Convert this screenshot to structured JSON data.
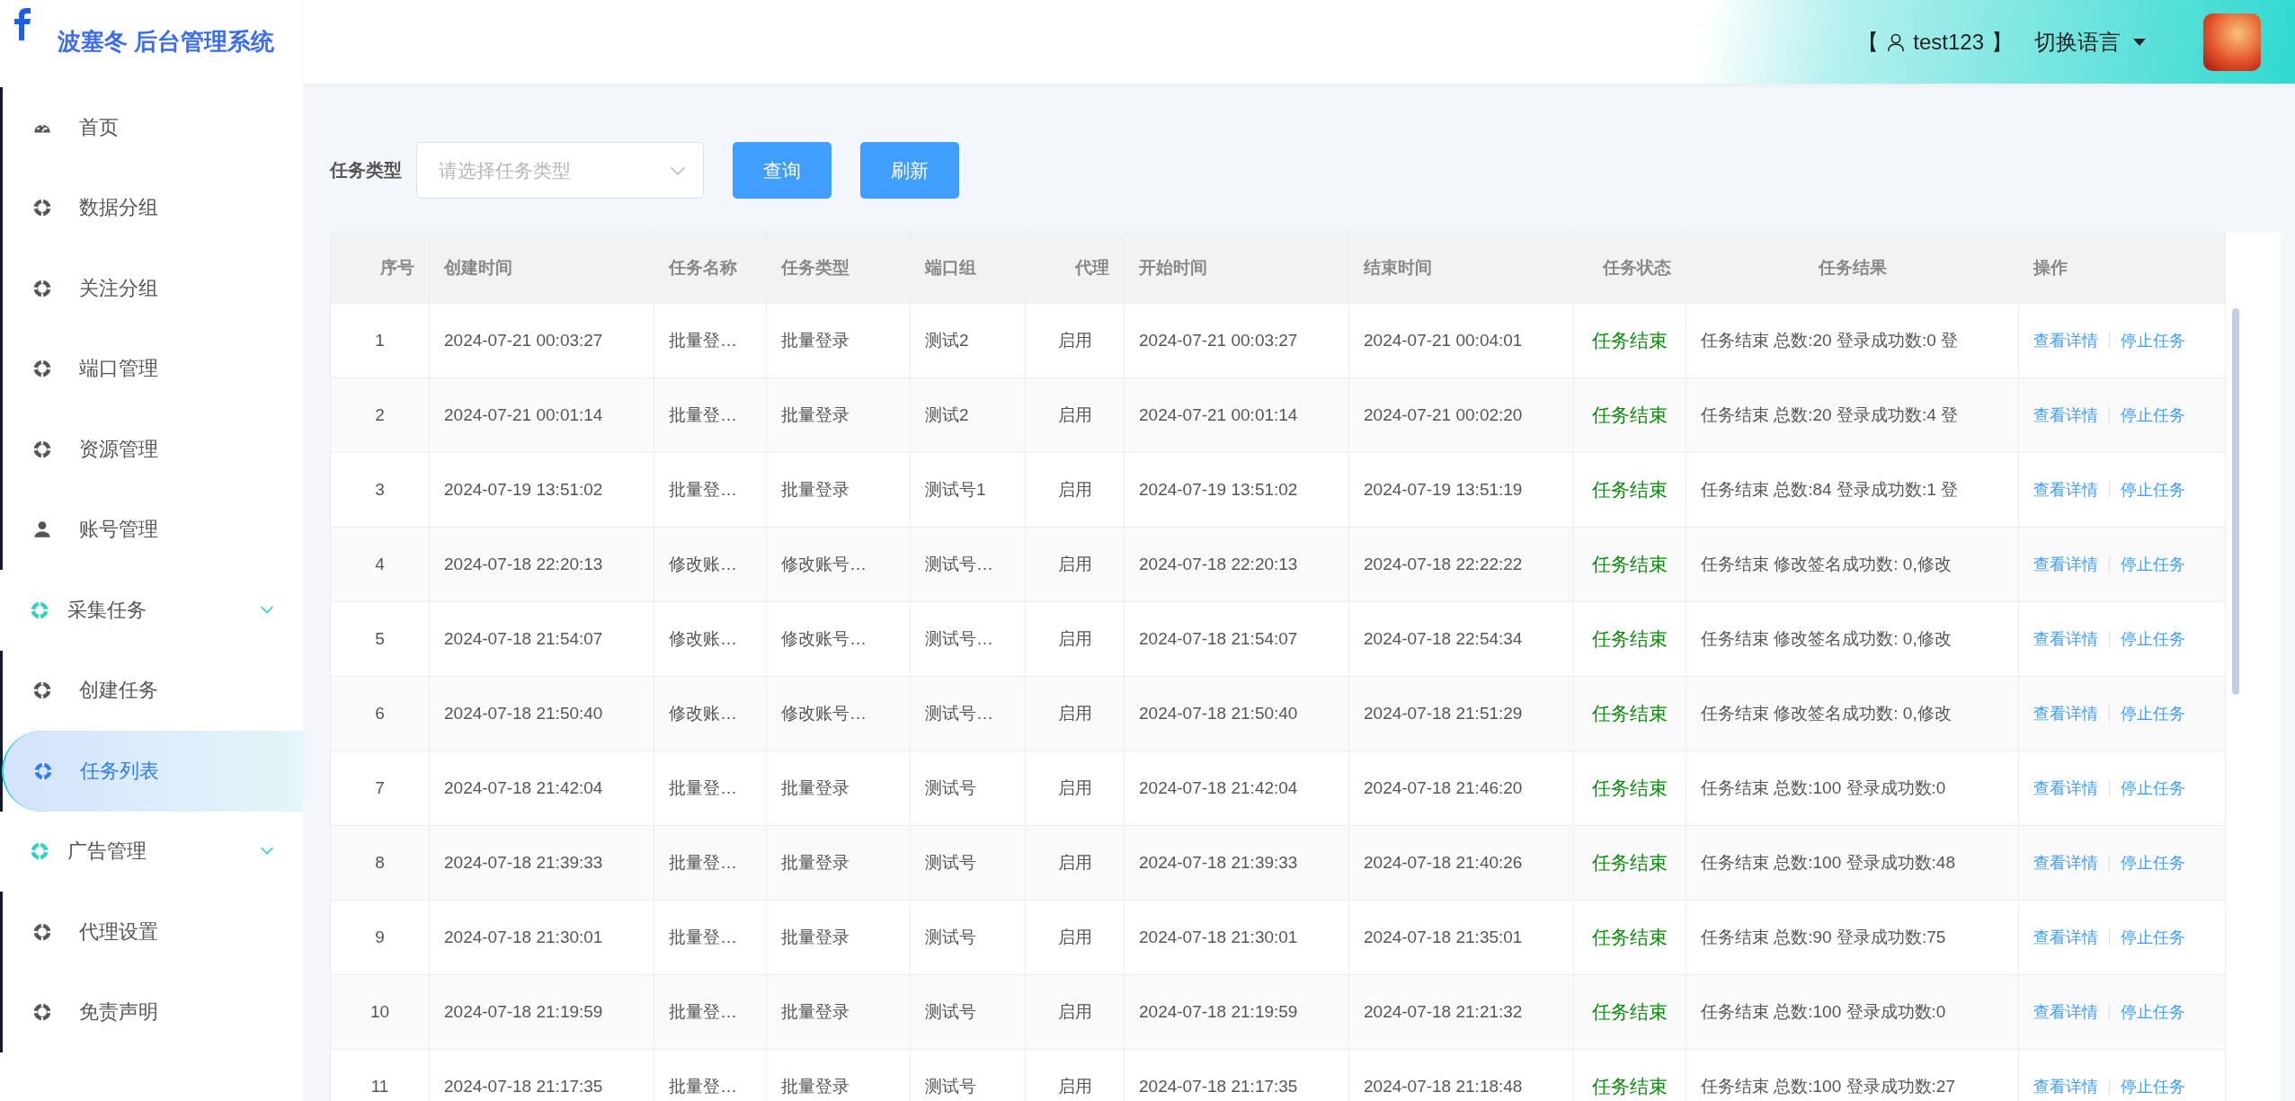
{
  "app": {
    "title": "波塞冬 后台管理系统"
  },
  "header": {
    "bracket_open": "【",
    "user": "test123",
    "bracket_close": "】",
    "language": "切换语言"
  },
  "sidebar": {
    "items": [
      {
        "label": "首页",
        "kind": "home",
        "selected": false
      },
      {
        "label": "数据分组",
        "kind": "item",
        "selected": false
      },
      {
        "label": "关注分组",
        "kind": "item",
        "selected": false
      },
      {
        "label": "端口管理",
        "kind": "item",
        "selected": false
      },
      {
        "label": "资源管理",
        "kind": "item",
        "selected": false
      },
      {
        "label": "账号管理",
        "kind": "account",
        "selected": false
      },
      {
        "label": "采集任务",
        "kind": "group",
        "expanded": true,
        "children": [
          {
            "label": "创建任务",
            "kind": "item",
            "selected": false
          },
          {
            "label": "任务列表",
            "kind": "item",
            "selected": true
          }
        ]
      },
      {
        "label": "广告管理",
        "kind": "group",
        "expanded": true,
        "children": [
          {
            "label": "代理设置",
            "kind": "item",
            "selected": false
          },
          {
            "label": "免责声明",
            "kind": "item",
            "selected": false
          }
        ]
      }
    ]
  },
  "filter": {
    "label": "任务类型",
    "placeholder": "请选择任务类型",
    "buttons": [
      "查询",
      "刷新"
    ]
  },
  "table": {
    "columns": [
      {
        "label": "序号",
        "kind": "index"
      },
      {
        "label": "创建时间",
        "kind": "text"
      },
      {
        "label": "任务名称",
        "kind": "text"
      },
      {
        "label": "任务类型",
        "kind": "text"
      },
      {
        "label": "端口组",
        "kind": "text"
      },
      {
        "label": "代理",
        "kind": "center"
      },
      {
        "label": "开始时间",
        "kind": "text"
      },
      {
        "label": "结束时间",
        "kind": "text"
      },
      {
        "label": "任务状态",
        "kind": "status"
      },
      {
        "label": "任务结果",
        "kind": "text"
      },
      {
        "label": "操作",
        "kind": "actions"
      }
    ],
    "rows": [
      {
        "cells": [
          "1",
          "2024-07-21 00:03:27",
          "批量登…",
          "批量登录",
          "测试2",
          "启用",
          "2024-07-21 00:03:27",
          "2024-07-21 00:04:01",
          "任务结束",
          "任务结束 总数:20 登录成功数:0 登"
        ],
        "actions": [
          "查看详情",
          "停止任务"
        ]
      },
      {
        "cells": [
          "2",
          "2024-07-21 00:01:14",
          "批量登…",
          "批量登录",
          "测试2",
          "启用",
          "2024-07-21 00:01:14",
          "2024-07-21 00:02:20",
          "任务结束",
          "任务结束 总数:20 登录成功数:4 登"
        ],
        "actions": [
          "查看详情",
          "停止任务"
        ]
      },
      {
        "cells": [
          "3",
          "2024-07-19 13:51:02",
          "批量登…",
          "批量登录",
          "测试号1",
          "启用",
          "2024-07-19 13:51:02",
          "2024-07-19 13:51:19",
          "任务结束",
          "任务结束 总数:84 登录成功数:1 登"
        ],
        "actions": [
          "查看详情",
          "停止任务"
        ]
      },
      {
        "cells": [
          "4",
          "2024-07-18 22:20:13",
          "修改账…",
          "修改账号…",
          "测试号…",
          "启用",
          "2024-07-18 22:20:13",
          "2024-07-18 22:22:22",
          "任务结束",
          "任务结束 修改签名成功数: 0,修改"
        ],
        "actions": [
          "查看详情",
          "停止任务"
        ]
      },
      {
        "cells": [
          "5",
          "2024-07-18 21:54:07",
          "修改账…",
          "修改账号…",
          "测试号…",
          "启用",
          "2024-07-18 21:54:07",
          "2024-07-18 22:54:34",
          "任务结束",
          "任务结束 修改签名成功数: 0,修改"
        ],
        "actions": [
          "查看详情",
          "停止任务"
        ]
      },
      {
        "cells": [
          "6",
          "2024-07-18 21:50:40",
          "修改账…",
          "修改账号…",
          "测试号…",
          "启用",
          "2024-07-18 21:50:40",
          "2024-07-18 21:51:29",
          "任务结束",
          "任务结束 修改签名成功数: 0,修改"
        ],
        "actions": [
          "查看详情",
          "停止任务"
        ]
      },
      {
        "cells": [
          "7",
          "2024-07-18 21:42:04",
          "批量登…",
          "批量登录",
          "测试号",
          "启用",
          "2024-07-18 21:42:04",
          "2024-07-18 21:46:20",
          "任务结束",
          "任务结束 总数:100 登录成功数:0"
        ],
        "actions": [
          "查看详情",
          "停止任务"
        ]
      },
      {
        "cells": [
          "8",
          "2024-07-18 21:39:33",
          "批量登…",
          "批量登录",
          "测试号",
          "启用",
          "2024-07-18 21:39:33",
          "2024-07-18 21:40:26",
          "任务结束",
          "任务结束 总数:100 登录成功数:48"
        ],
        "actions": [
          "查看详情",
          "停止任务"
        ]
      },
      {
        "cells": [
          "9",
          "2024-07-18 21:30:01",
          "批量登…",
          "批量登录",
          "测试号",
          "启用",
          "2024-07-18 21:30:01",
          "2024-07-18 21:35:01",
          "任务结束",
          "任务结束 总数:90 登录成功数:75"
        ],
        "actions": [
          "查看详情",
          "停止任务"
        ]
      },
      {
        "cells": [
          "10",
          "2024-07-18 21:19:59",
          "批量登…",
          "批量登录",
          "测试号",
          "启用",
          "2024-07-18 21:19:59",
          "2024-07-18 21:21:32",
          "任务结束",
          "任务结束 总数:100 登录成功数:0"
        ],
        "actions": [
          "查看详情",
          "停止任务"
        ]
      },
      {
        "cells": [
          "11",
          "2024-07-18 21:17:35",
          "批量登…",
          "批量登录",
          "测试号",
          "启用",
          "2024-07-18 21:17:35",
          "2024-07-18 21:18:48",
          "任务结束",
          "任务结束 总数:100 登录成功数:27"
        ],
        "actions": [
          "查看详情",
          "停止任务"
        ]
      }
    ]
  }
}
